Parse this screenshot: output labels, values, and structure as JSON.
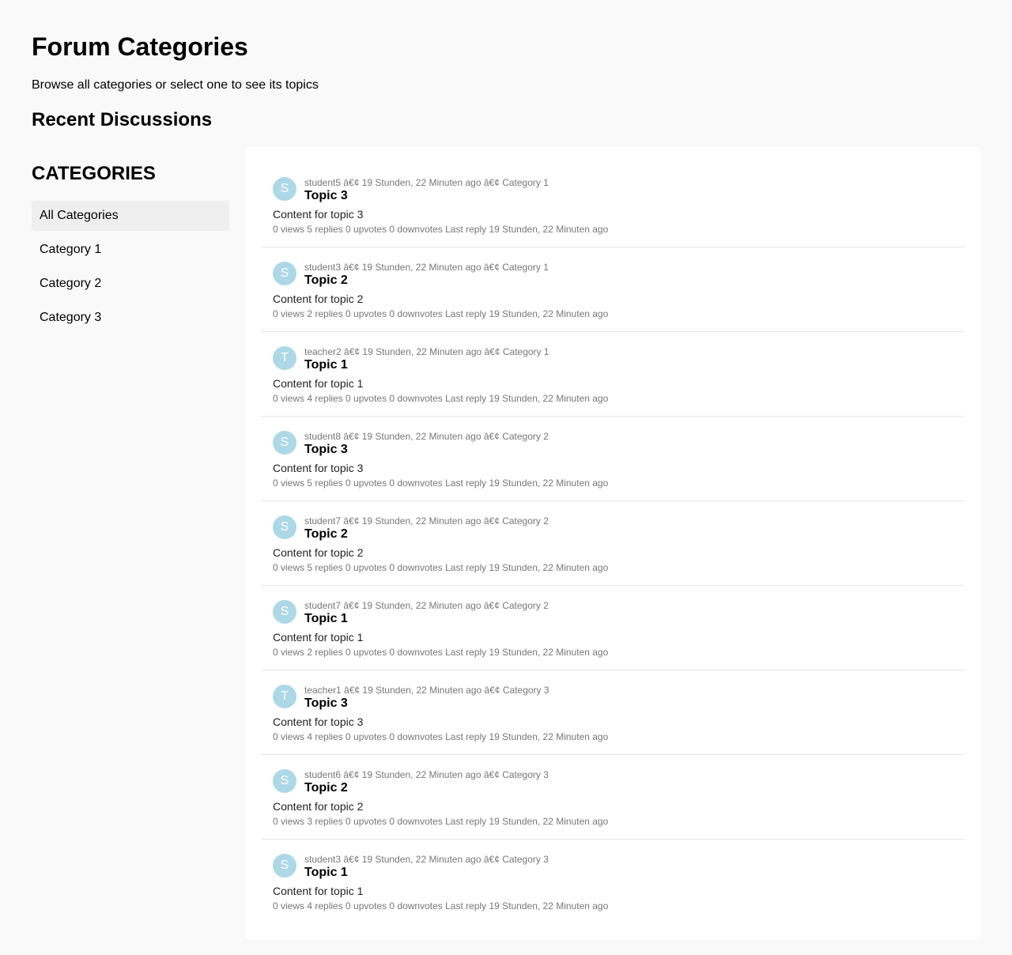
{
  "header": {
    "title": "Forum Categories",
    "subtitle": "Browse all categories or select one to see its topics",
    "section_title": "Recent Discussions"
  },
  "sidebar": {
    "heading": "CATEGORIES",
    "items": [
      {
        "label": "All Categories",
        "active": true
      },
      {
        "label": "Category 1"
      },
      {
        "label": "Category 2"
      },
      {
        "label": "Category 3"
      }
    ]
  },
  "colors": {
    "avatar_bg": "#add8e6",
    "active_item_bg": "#efefef",
    "page_bg": "#f9f9f9"
  },
  "topics": [
    {
      "initial": "S",
      "meta": "student5 â€¢ 19 Stunden, 22 Minuten ago â€¢ Category 1",
      "title": "Topic 3",
      "content": "Content for topic 3",
      "stats": "0 views 5 replies 0 upvotes 0 downvotes Last reply 19 Stunden, 22 Minuten ago"
    },
    {
      "initial": "S",
      "meta": "student3 â€¢ 19 Stunden, 22 Minuten ago â€¢ Category 1",
      "title": "Topic 2",
      "content": "Content for topic 2",
      "stats": "0 views 2 replies 0 upvotes 0 downvotes Last reply 19 Stunden, 22 Minuten ago"
    },
    {
      "initial": "T",
      "meta": "teacher2 â€¢ 19 Stunden, 22 Minuten ago â€¢ Category 1",
      "title": "Topic 1",
      "content": "Content for topic 1",
      "stats": "0 views 4 replies 0 upvotes 0 downvotes Last reply 19 Stunden, 22 Minuten ago"
    },
    {
      "initial": "S",
      "meta": "student8 â€¢ 19 Stunden, 22 Minuten ago â€¢ Category 2",
      "title": "Topic 3",
      "content": "Content for topic 3",
      "stats": "0 views 5 replies 0 upvotes 0 downvotes Last reply 19 Stunden, 22 Minuten ago"
    },
    {
      "initial": "S",
      "meta": "student7 â€¢ 19 Stunden, 22 Minuten ago â€¢ Category 2",
      "title": "Topic 2",
      "content": "Content for topic 2",
      "stats": "0 views 5 replies 0 upvotes 0 downvotes Last reply 19 Stunden, 22 Minuten ago"
    },
    {
      "initial": "S",
      "meta": "student7 â€¢ 19 Stunden, 22 Minuten ago â€¢ Category 2",
      "title": "Topic 1",
      "content": "Content for topic 1",
      "stats": "0 views 2 replies 0 upvotes 0 downvotes Last reply 19 Stunden, 22 Minuten ago"
    },
    {
      "initial": "T",
      "meta": "teacher1 â€¢ 19 Stunden, 22 Minuten ago â€¢ Category 3",
      "title": "Topic 3",
      "content": "Content for topic 3",
      "stats": "0 views 4 replies 0 upvotes 0 downvotes Last reply 19 Stunden, 22 Minuten ago"
    },
    {
      "initial": "S",
      "meta": "student6 â€¢ 19 Stunden, 22 Minuten ago â€¢ Category 3",
      "title": "Topic 2",
      "content": "Content for topic 2",
      "stats": "0 views 3 replies 0 upvotes 0 downvotes Last reply 19 Stunden, 22 Minuten ago"
    },
    {
      "initial": "S",
      "meta": "student3 â€¢ 19 Stunden, 22 Minuten ago â€¢ Category 3",
      "title": "Topic 1",
      "content": "Content for topic 1",
      "stats": "0 views 4 replies 0 upvotes 0 downvotes Last reply 19 Stunden, 22 Minuten ago"
    }
  ]
}
